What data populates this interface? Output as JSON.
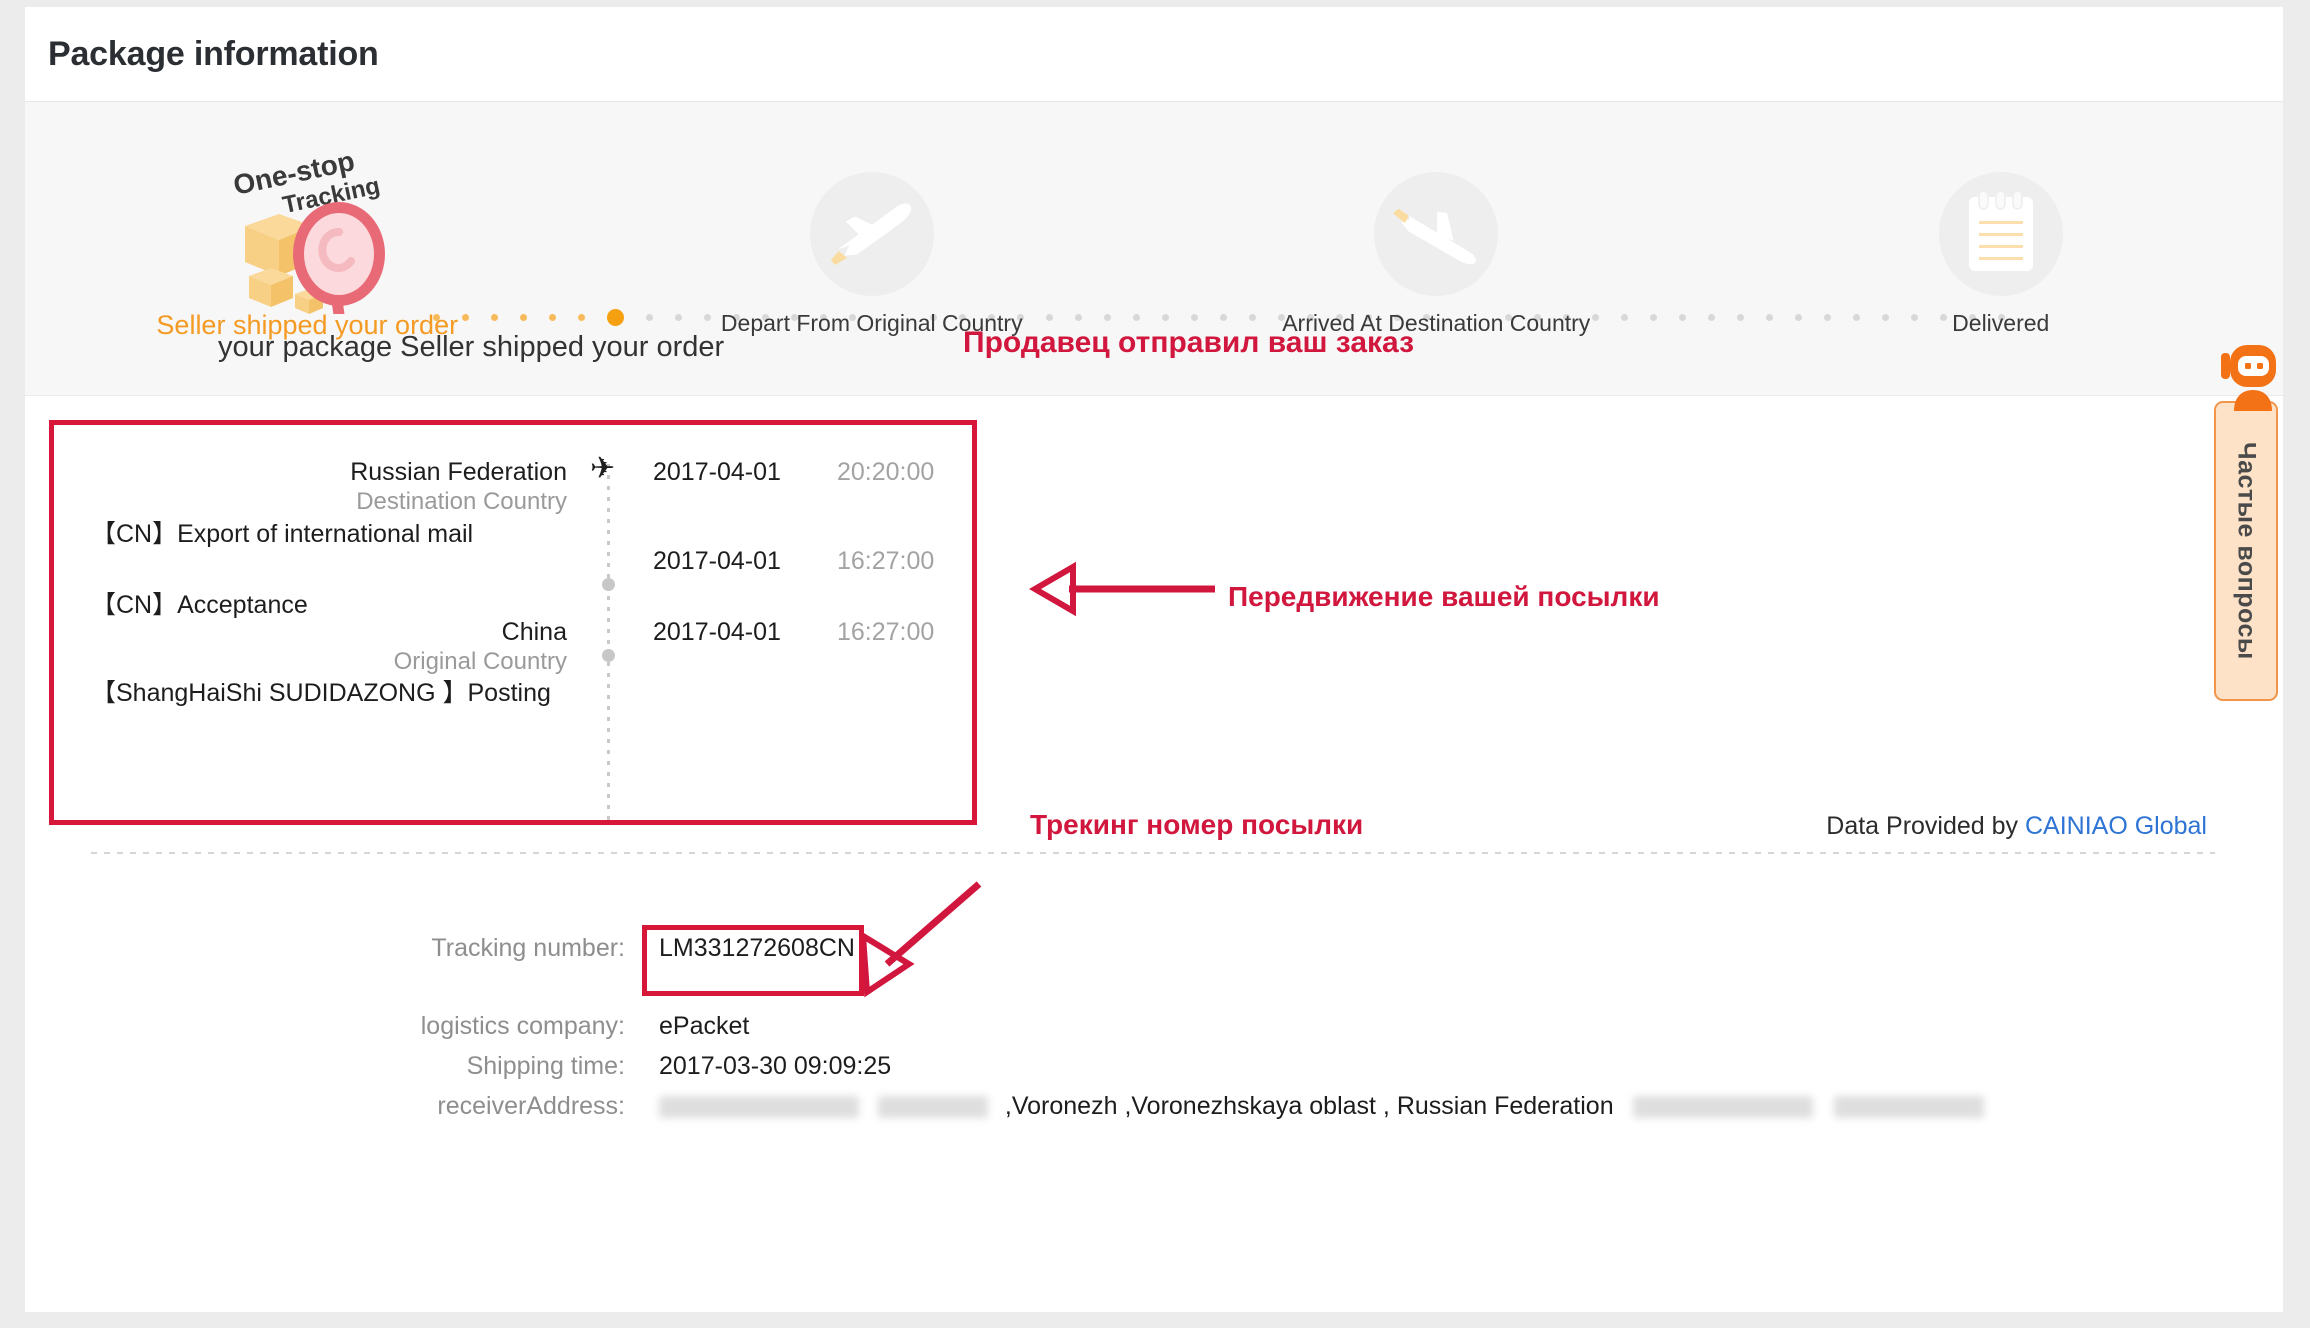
{
  "header": {
    "title": "Package information"
  },
  "colors": {
    "accent_orange": "#f5a011",
    "annotation_red": "#d1173d",
    "status_red": "#e02e16",
    "link_blue": "#2d74d4"
  },
  "progress": {
    "logo_line1": "One-stop",
    "logo_line2": "Tracking",
    "steps": [
      {
        "label": "Seller shipped your order",
        "icon": "one-stop-tracking-logo",
        "state": "active"
      },
      {
        "label": "Depart From Original Country",
        "icon": "airplane-takeoff-icon",
        "state": "pending"
      },
      {
        "label": "Arrived At Destination Country",
        "icon": "airplane-landing-icon",
        "state": "pending"
      },
      {
        "label": "Delivered",
        "icon": "receipt-notes-icon",
        "state": "pending"
      }
    ]
  },
  "status": {
    "prefix": "your package ",
    "highlight": "Seller shipped your order"
  },
  "annotations": {
    "order_shipped_ru": "Продавец отправил ваш заказ",
    "movement_ru": "Передвижение вашей посылки",
    "tracking_number_ru": "Трекинг номер посылки"
  },
  "timeline": {
    "events": [
      {
        "country": "Russian Federation",
        "country_sub": "Destination Country",
        "description": "【CN】Export of international mail",
        "date": "2017-04-01",
        "time": "20:20:00",
        "marker": "plane"
      },
      {
        "country": "",
        "country_sub": "",
        "description": "【CN】Acceptance",
        "date": "2017-04-01",
        "time": "16:27:00",
        "marker": "dot"
      },
      {
        "country": "China",
        "country_sub": "Original Country",
        "description": "【ShangHaiShi SUDIDAZONG 】Posting",
        "date": "2017-04-01",
        "time": "16:27:00",
        "marker": "dot"
      }
    ]
  },
  "provided": {
    "prefix": "Data Provided by ",
    "link": "CAINIAO Global"
  },
  "details": {
    "rows": [
      {
        "label": "Tracking number:",
        "value": "LM331272608CN"
      },
      {
        "label": "logistics company:",
        "value": "ePacket"
      },
      {
        "label": "Shipping time:",
        "value": "2017-03-30 09:09:25"
      }
    ],
    "receiver_label": "receiverAddress:",
    "receiver_value": ",Voronezh ,Voronezhskaya oblast , Russian Federation"
  },
  "faq_widget": {
    "label": "Частые вопросы",
    "icon": "robot-icon"
  }
}
